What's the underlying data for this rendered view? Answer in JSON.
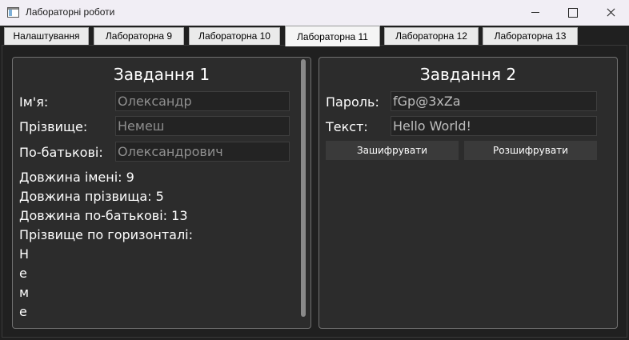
{
  "window": {
    "title": "Лабораторні роботи"
  },
  "tabs": [
    {
      "label": "Налаштування"
    },
    {
      "label": "Лабораторна 9"
    },
    {
      "label": "Лабораторна 10"
    },
    {
      "label": "Лабораторна 11",
      "active": true
    },
    {
      "label": "Лабораторна 12"
    },
    {
      "label": "Лабораторна 13"
    }
  ],
  "task1": {
    "title": "Завдання 1",
    "name_label": "Ім'я:",
    "name_value": "Олександр",
    "surname_label": "Прізвище:",
    "surname_value": "Немеш",
    "patronymic_label": "По-батькові:",
    "patronymic_value": "Олександрович",
    "name_length": "Довжина імені: 9",
    "surname_length": "Довжина прізвища: 5",
    "patronymic_length": "Довжина по-батькові: 13",
    "vertical_heading": "Прізвище по горизонталі:",
    "vertical_letters": [
      "Н",
      "е",
      "м",
      "е"
    ]
  },
  "task2": {
    "title": "Завдання 2",
    "password_label": "Пароль:",
    "password_value": "fGp@3xZa",
    "text_label": "Текст:",
    "text_value": "Hello World!",
    "encrypt_label": "Зашифрувати",
    "decrypt_label": "Розшифрувати"
  },
  "colors": {
    "background": "#202020",
    "panel": "#2c2c2c",
    "input": "#232323",
    "button": "#3a3a3a"
  }
}
